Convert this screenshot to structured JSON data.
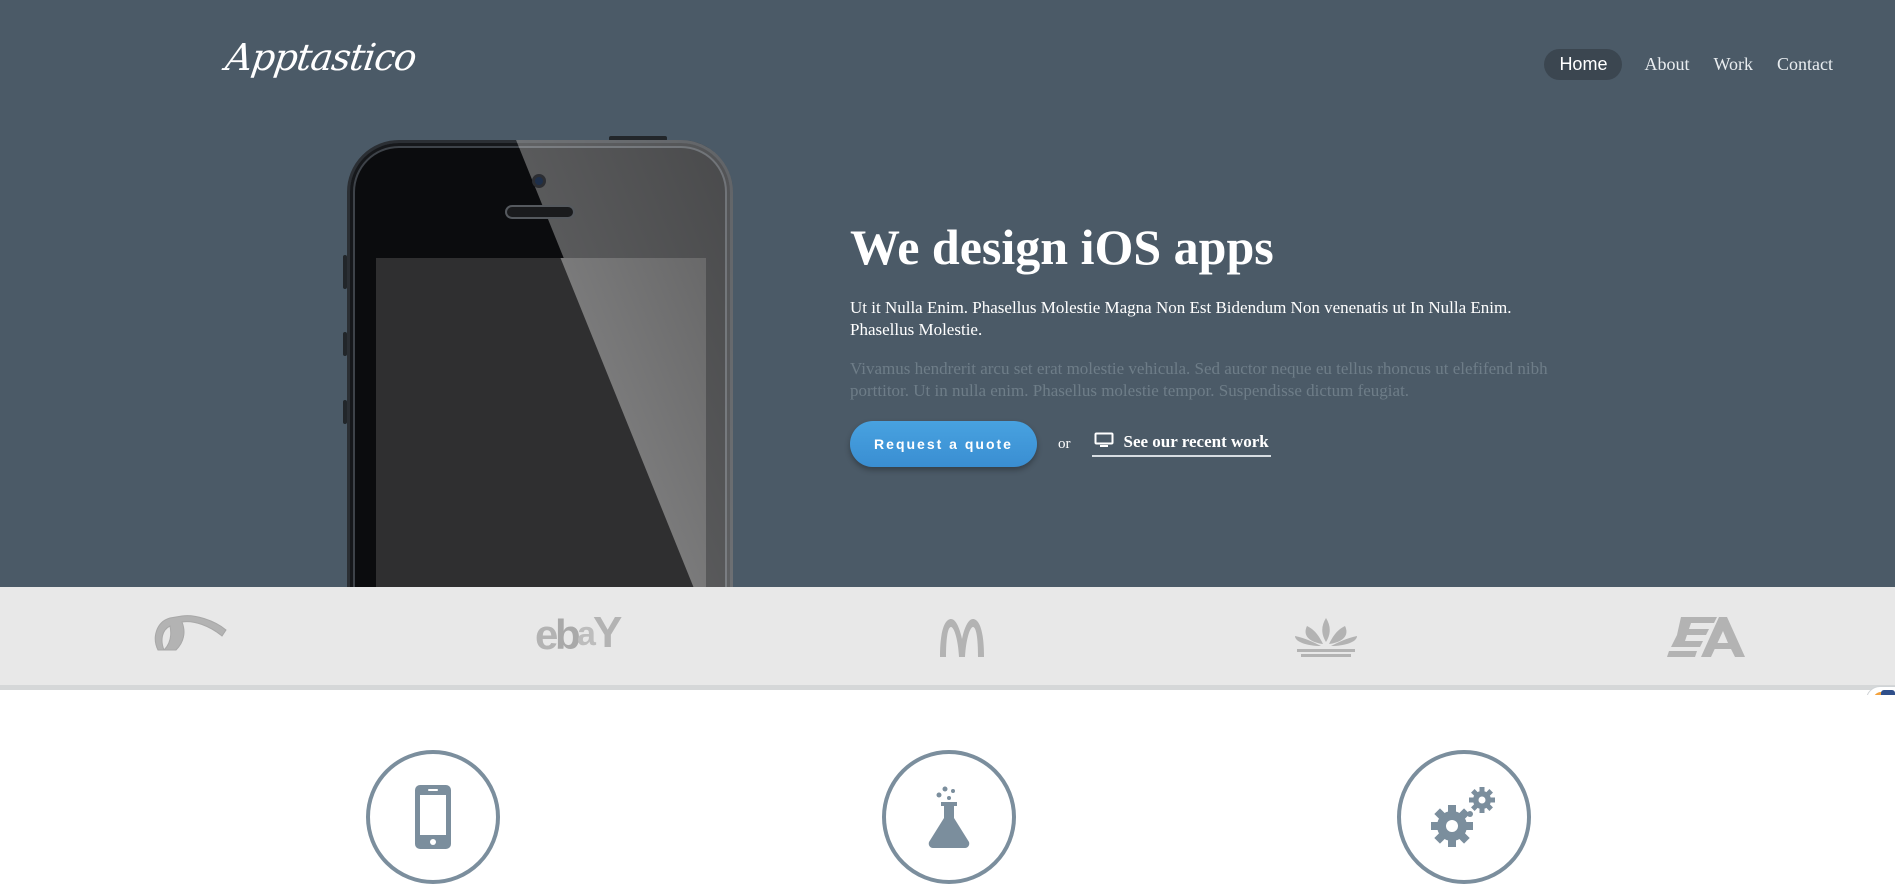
{
  "brand": {
    "logo_text": "Apptastico"
  },
  "nav": {
    "items": [
      {
        "label": "Home",
        "active": true
      },
      {
        "label": "About",
        "active": false
      },
      {
        "label": "Work",
        "active": false
      },
      {
        "label": "Contact",
        "active": false
      }
    ]
  },
  "hero": {
    "headline": "We design iOS apps",
    "lead": "Ut it Nulla Enim. Phasellus Molestie Magna Non Est Bidendum Non venenatis ut In Nulla Enim. Phasellus Molestie.",
    "sub": "Vivamus hendrerit arcu set erat molestie vehicula. Sed auctor neque eu tellus rhoncus ut elefifend nibh porttitor. Ut in nulla enim. Phasellus molestie tempor. Suspendisse dictum feugiat.",
    "cta_label": "Request a quote",
    "or_text": "or",
    "work_link_label": "See our recent work",
    "work_link_icon": "monitor-icon"
  },
  "clients": {
    "logos": [
      {
        "name": "deviantart-logo",
        "text": ""
      },
      {
        "name": "ebay-logo",
        "text": "ebY"
      },
      {
        "name": "mcdonalds-logo",
        "text": ""
      },
      {
        "name": "adidas-logo",
        "text": ""
      },
      {
        "name": "ea-logo",
        "text": "EA"
      }
    ]
  },
  "features": {
    "icons": [
      "mobile-phone-icon",
      "lab-flask-icon",
      "gears-icon"
    ]
  },
  "colors": {
    "hero_bg": "#4b5a67",
    "accent_blue": "#3a8ed2",
    "strip_bg": "#e8e8e8",
    "icon_gray": "#7b8e9d",
    "logo_gray": "#b3b3b3"
  }
}
